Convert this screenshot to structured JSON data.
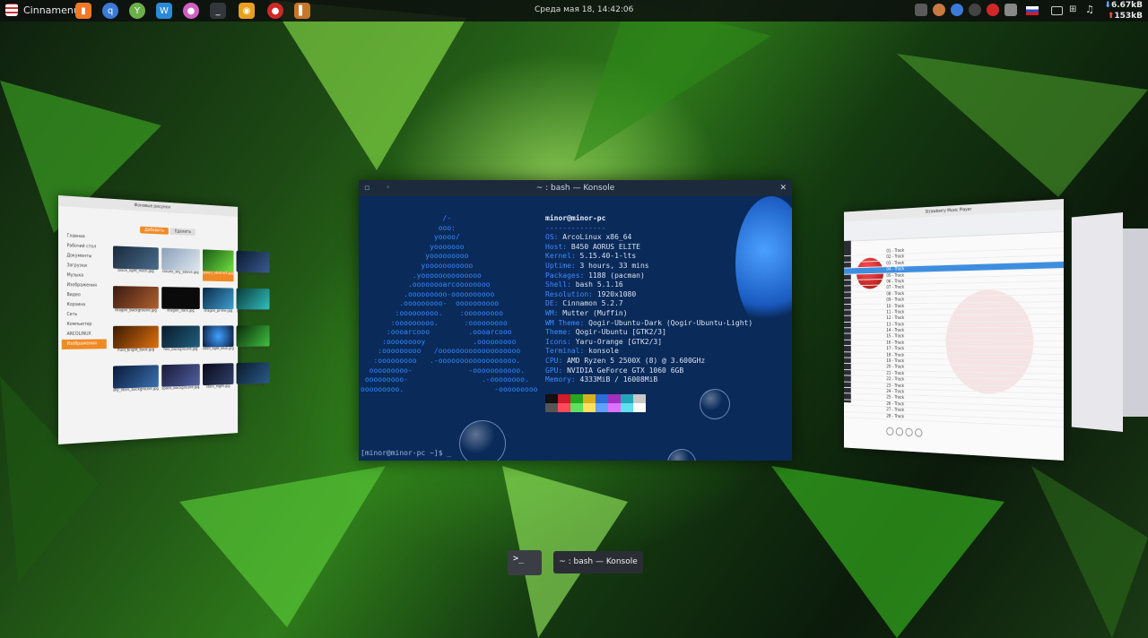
{
  "panel": {
    "menu_label": "Cinnamenu",
    "clock": "Среда мая 18, 14:42:06",
    "net_down": "6.67kB",
    "net_up": "153kB",
    "launchers": [
      "files-icon",
      "qbittorrent-icon",
      "app-icon",
      "kwrite-icon",
      "media-icon",
      "terminal-icon",
      "camera-icon",
      "strawberry-icon",
      "book-icon"
    ]
  },
  "konsole": {
    "title": "~ : bash — Konsole",
    "prompt": "[minor@minor-pc ~]$ _",
    "user_host": "minor@minor-pc",
    "separator": "--------------",
    "info": [
      {
        "k": "OS",
        "v": "ArcoLinux x86_64"
      },
      {
        "k": "Host",
        "v": "B450 AORUS ELITE"
      },
      {
        "k": "Kernel",
        "v": "5.15.40-1-lts"
      },
      {
        "k": "Uptime",
        "v": "3 hours, 33 mins"
      },
      {
        "k": "Packages",
        "v": "1188 (pacman)"
      },
      {
        "k": "Shell",
        "v": "bash 5.1.16"
      },
      {
        "k": "Resolution",
        "v": "1920x1080"
      },
      {
        "k": "DE",
        "v": "Cinnamon 5.2.7"
      },
      {
        "k": "WM",
        "v": "Mutter (Muffin)"
      },
      {
        "k": "WM Theme",
        "v": "Qogir-Ubuntu-Dark (Qogir-Ubuntu-Light)"
      },
      {
        "k": "Theme",
        "v": "Qogir-Ubuntu [GTK2/3]"
      },
      {
        "k": "Icons",
        "v": "Yaru-Orange [GTK2/3]"
      },
      {
        "k": "Terminal",
        "v": "konsole"
      },
      {
        "k": "CPU",
        "v": "AMD Ryzen 5 2500X (8) @ 3.600GHz"
      },
      {
        "k": "GPU",
        "v": "NVIDIA GeForce GTX 1060 6GB"
      },
      {
        "k": "Memory",
        "v": "4333MiB / 16008MiB"
      }
    ],
    "palette": [
      "#111111",
      "#d11a2a",
      "#23a820",
      "#d8b020",
      "#2a6cd8",
      "#a030c0",
      "#20a8b8",
      "#c8c8c8",
      "#555555",
      "#ff4a5a",
      "#60e060",
      "#ffe060",
      "#60a0ff",
      "#e070ff",
      "#60e0f0",
      "#ffffff"
    ]
  },
  "file_manager": {
    "title": "Фоновые рисунки",
    "tabs": [
      "Добавить",
      "Удалить"
    ],
    "sidebar": [
      "Главная",
      "Рабочий стол",
      "Документы",
      "Загрузки",
      "Музыка",
      "Изображения",
      "Видео",
      "Корзина",
      "Сеть",
      "Компьютер",
      "ARCOLINUX",
      "Изображения"
    ],
    "thumbs": [
      "black_light_neon.jpg",
      "clouds_sky_above.jpg",
      "green_abstract.jpg",
      "dark_neon_sky.jpg",
      "dragon_background.jpg",
      "dragon_dark.jpg",
      "dragon_prime.jpg",
      "glow_background.jpg",
      "fluid_bright_back.jpg",
      "hex_background.jpg",
      "neon_light_blue.jpg",
      "pattern_green.jpg",
      "sky_stars_background.jpg",
      "space_background.jpg",
      "stars_night.jpg",
      "space_blue.jpg"
    ]
  },
  "player": {
    "title": "Strawberry Music Player",
    "rows": [
      "01 - Track",
      "02 - Track",
      "03 - Track",
      "04 - Track",
      "05 - Track",
      "06 - Track",
      "07 - Track",
      "08 - Track",
      "09 - Track",
      "10 - Track",
      "11 - Track",
      "12 - Track",
      "13 - Track",
      "14 - Track",
      "15 - Track",
      "16 - Track",
      "17 - Track",
      "18 - Track",
      "19 - Track",
      "20 - Track",
      "21 - Track",
      "22 - Track",
      "23 - Track",
      "24 - Track",
      "25 - Track",
      "26 - Track",
      "27 - Track",
      "28 - Track"
    ]
  },
  "switcher": {
    "icon_text": ">_",
    "label": "~ : bash — Konsole"
  },
  "colors": {
    "accent": "#f08a24",
    "term_blue": "#2f8cff",
    "selection": "#3d8ee0"
  }
}
